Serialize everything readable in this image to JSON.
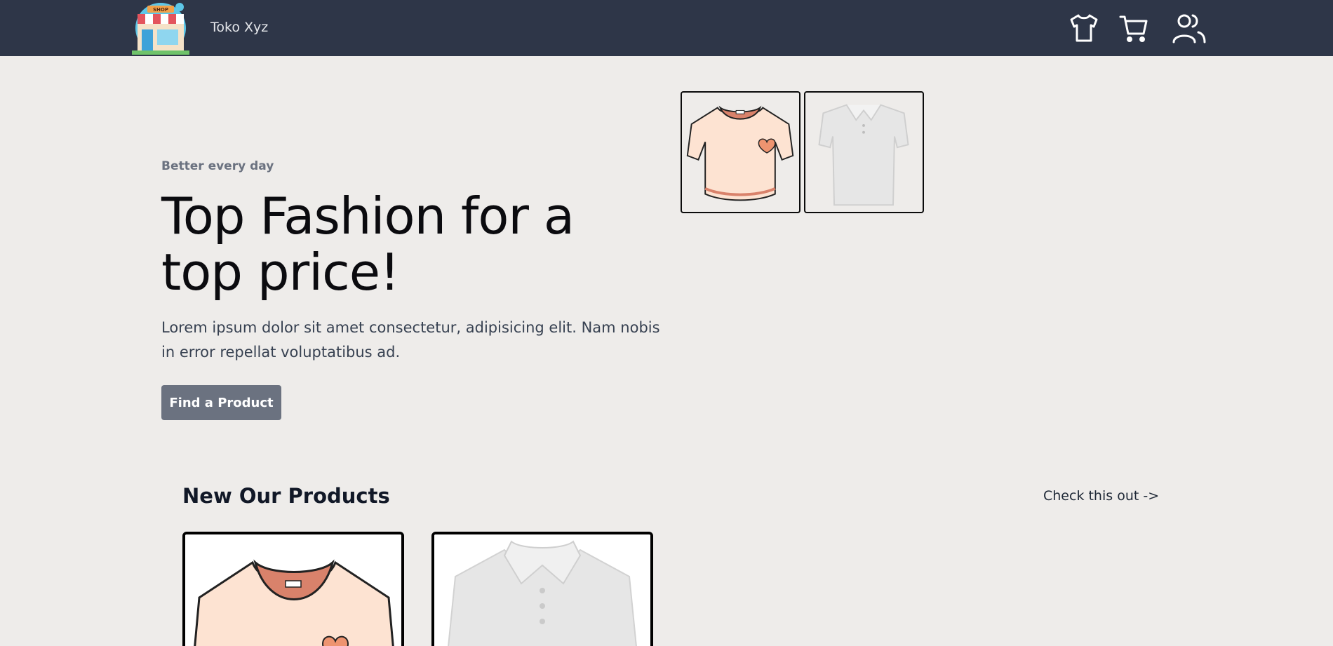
{
  "navbar": {
    "brand": "Toko Xyz",
    "logo_icon": "shop-storefront-icon",
    "icons": [
      "tshirt-icon",
      "cart-icon",
      "users-icon"
    ],
    "background": "#2e3648"
  },
  "hero": {
    "eyebrow": "Better every day",
    "title": "Top Fashion for a top price!",
    "description": "Lorem ipsum dolor sit amet consectetur, adipisicing elit. Nam nobis in error repellat voluptatibus ad.",
    "cta_label": "Find a Product",
    "cta_color": "#6b7280",
    "thumbnails": [
      "peach-tshirt-image",
      "white-polo-image"
    ]
  },
  "products": {
    "title": "New Our Products",
    "link_label": "Check this out ->",
    "cards": [
      "peach-tshirt-image",
      "white-polo-image"
    ]
  },
  "colors": {
    "page_background": "#eeecea",
    "peach": "#fde3d2",
    "peach_dark": "#d9826b",
    "polo_white": "#e6e6e6"
  }
}
